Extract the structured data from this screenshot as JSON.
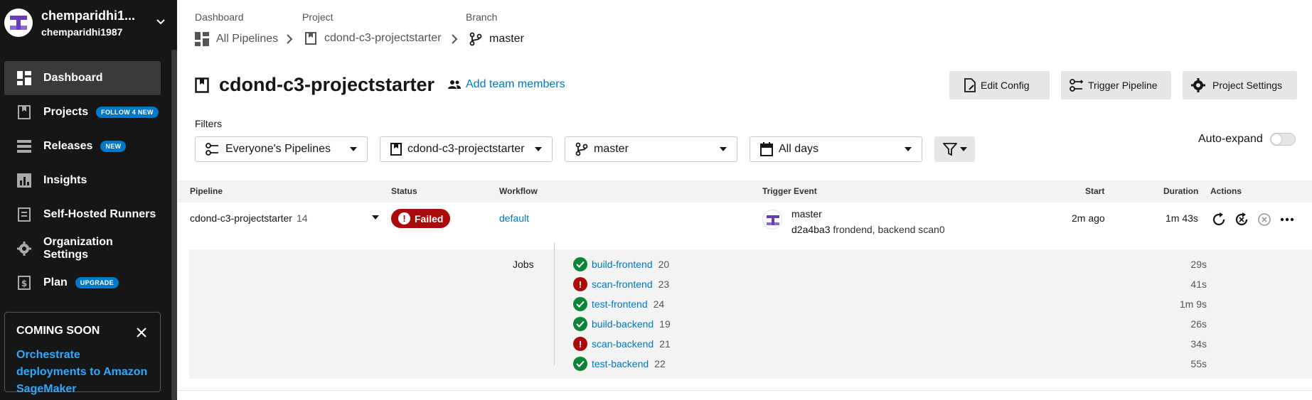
{
  "org": {
    "name": "chemparidhi1...",
    "username": "chemparidhi1987"
  },
  "nav": [
    {
      "label": "Dashboard",
      "icon": "dashboard-icon",
      "active": true
    },
    {
      "label": "Projects",
      "icon": "projects-icon",
      "badge": "FOLLOW 4 NEW"
    },
    {
      "label": "Releases",
      "icon": "releases-icon",
      "badge": "NEW"
    },
    {
      "label": "Insights",
      "icon": "insights-icon"
    },
    {
      "label": "Self-Hosted Runners",
      "icon": "runners-icon"
    },
    {
      "label": "Organization Settings",
      "icon": "gear-icon"
    },
    {
      "label": "Plan",
      "icon": "plan-icon",
      "badge": "UPGRADE"
    }
  ],
  "coming_soon": {
    "heading": "COMING SOON",
    "link": "Orchestrate deployments to Amazon SageMaker"
  },
  "breadcrumb": {
    "dashboard_label": "Dashboard",
    "dashboard_value": "All Pipelines",
    "project_label": "Project",
    "project_value": "cdond-c3-projectstarter",
    "branch_label": "Branch",
    "branch_value": "master"
  },
  "page": {
    "title": "cdond-c3-projectstarter",
    "add_team": "Add team members"
  },
  "toolbar": {
    "edit_config": "Edit Config",
    "trigger_pipeline": "Trigger Pipeline",
    "project_settings": "Project Settings"
  },
  "filters": {
    "label": "Filters",
    "pipelines": "Everyone's Pipelines",
    "project": "cdond-c3-projectstarter",
    "branch": "master",
    "days": "All days",
    "auto_expand": "Auto-expand"
  },
  "table": {
    "headers": {
      "pipeline": "Pipeline",
      "status": "Status",
      "workflow": "Workflow",
      "trigger": "Trigger Event",
      "start": "Start",
      "duration": "Duration",
      "actions": "Actions"
    },
    "row": {
      "pipeline": "cdond-c3-projectstarter",
      "number": "14",
      "status": "Failed",
      "workflow": "default",
      "branch": "master",
      "commit_hash": "d2a4ba3",
      "commit_msg": "frondend, backend scan0",
      "start": "2m ago",
      "duration": "1m 43s"
    },
    "jobs_label": "Jobs",
    "jobs": [
      {
        "name": "build-frontend",
        "num": "20",
        "status": "success",
        "duration": "29s"
      },
      {
        "name": "scan-frontend",
        "num": "23",
        "status": "failed",
        "duration": "41s"
      },
      {
        "name": "test-frontend",
        "num": "24",
        "status": "success",
        "duration": "1m 9s"
      },
      {
        "name": "build-backend",
        "num": "19",
        "status": "success",
        "duration": "26s"
      },
      {
        "name": "scan-backend",
        "num": "21",
        "status": "failed",
        "duration": "34s"
      },
      {
        "name": "test-backend",
        "num": "22",
        "status": "success",
        "duration": "55s"
      }
    ]
  },
  "colors": {
    "accent": "#0078ca",
    "failed": "#ab0a0a",
    "success": "#0a8436",
    "sidebar": "#161616"
  }
}
